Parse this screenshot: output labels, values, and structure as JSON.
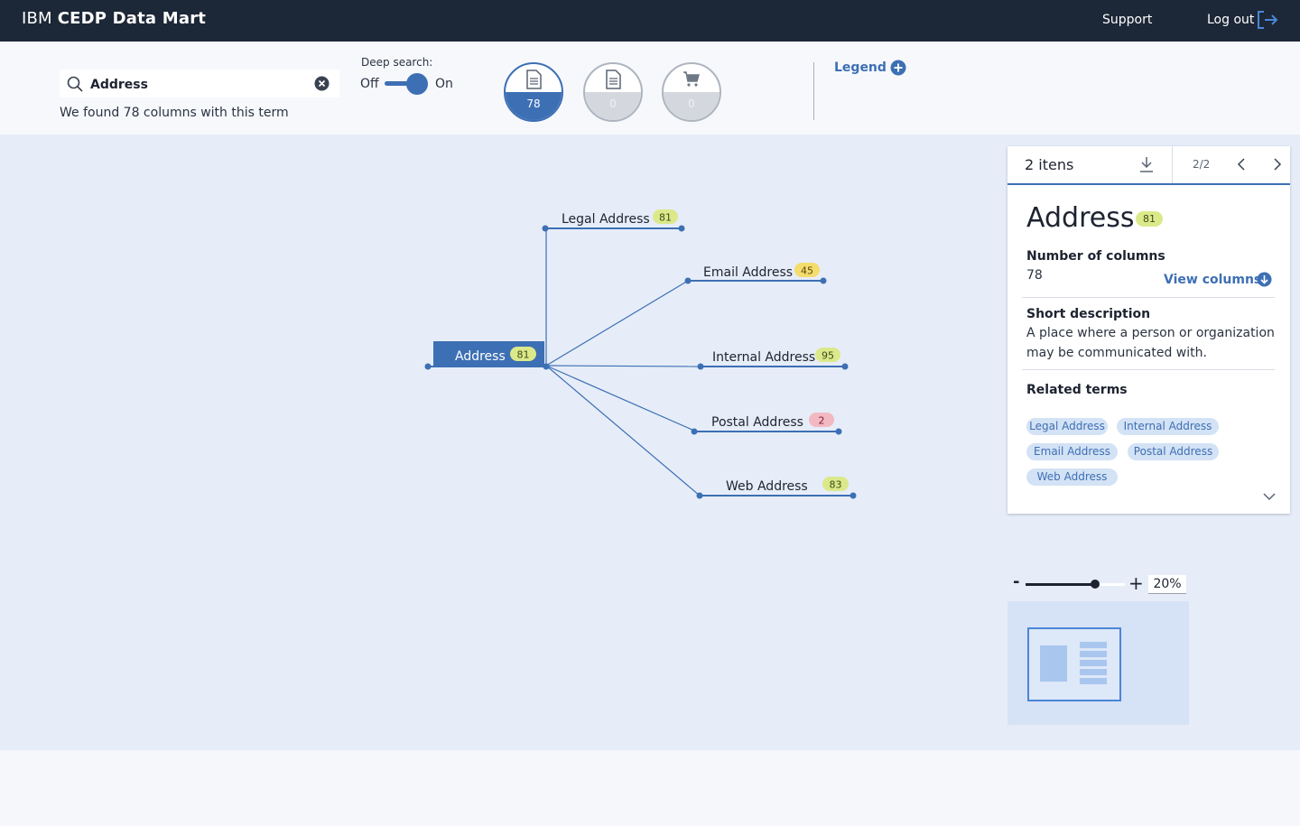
{
  "header": {
    "brand_prefix": "IBM",
    "brand_name": "CEDP Data Mart",
    "support": "Support",
    "logout": "Log out"
  },
  "search": {
    "value": "Address",
    "result_text": "We found 78 columns with this term",
    "deep_search_label": "Deep search:",
    "toggle_off": "Off",
    "toggle_on": "On",
    "deep_search_enabled": true
  },
  "filters": [
    {
      "icon": "document-icon",
      "count": "78",
      "active": true
    },
    {
      "icon": "document-icon",
      "count": "0",
      "active": false
    },
    {
      "icon": "cart-icon",
      "count": "0",
      "active": false
    }
  ],
  "legend": {
    "label": "Legend"
  },
  "graph": {
    "root": {
      "label": "Address",
      "count": "81"
    },
    "nodes": [
      {
        "label": "Legal Address",
        "count": "81",
        "status": "green"
      },
      {
        "label": "Email Address",
        "count": "45",
        "status": "yellow"
      },
      {
        "label": "Internal Address",
        "count": "95",
        "status": "green"
      },
      {
        "label": "Postal Address",
        "count": "2",
        "status": "red"
      },
      {
        "label": "Web Address",
        "count": "83",
        "status": "green"
      }
    ]
  },
  "panel": {
    "items_label": "2 itens",
    "page": "2/2",
    "title": "Address",
    "title_count": "81",
    "columns_label": "Number of columns",
    "columns_value": "78",
    "view_columns": "View columns",
    "desc_label": "Short description",
    "desc_line1": "A place where a person or organization",
    "desc_line2": "may be communicated with.",
    "related_label": "Related terms",
    "related_terms": [
      "Legal Address",
      "Internal Address",
      "Email Address",
      "Postal Address",
      "Web Address"
    ]
  },
  "zoom": {
    "value": "20%",
    "level": 0.7
  },
  "colors": {
    "accent": "#3d6fb4",
    "header_bg": "#1c2737",
    "canvas_bg": "#e6edf8",
    "badge_green": "#dbe98a",
    "badge_yellow": "#f5dc6c",
    "badge_red": "#f3b9c3"
  }
}
